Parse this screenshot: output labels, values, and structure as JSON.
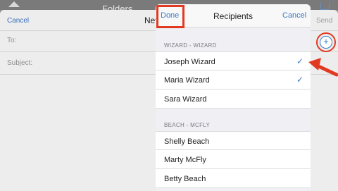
{
  "background": {
    "folders_label": "Folders"
  },
  "compose": {
    "cancel": "Cancel",
    "title": "New",
    "send": "Send",
    "to_label": "To:",
    "subject_label": "Subject:"
  },
  "recipients": {
    "done": "Done",
    "title": "Recipients",
    "cancel": "Cancel",
    "sections": [
      {
        "header": "WIZARD - WIZARD",
        "items": [
          {
            "name": "Joseph Wizard",
            "checked": true
          },
          {
            "name": "Maria Wizard",
            "checked": true
          },
          {
            "name": "Sara Wizard",
            "checked": false
          }
        ]
      },
      {
        "header": "BEACH - MCFLY",
        "items": [
          {
            "name": "Shelly Beach",
            "checked": false
          },
          {
            "name": "Marty McFly",
            "checked": false
          },
          {
            "name": "Betty Beach",
            "checked": false
          }
        ]
      }
    ],
    "check_glyph": "✓"
  },
  "add_button_glyph": "+",
  "colors": {
    "accent": "#3b78c9",
    "highlight": "#e23a22"
  },
  "icons": [
    "home-icon",
    "compose-icon",
    "add-contact-icon",
    "checkmark-icon",
    "arrow-annotation-icon"
  ]
}
